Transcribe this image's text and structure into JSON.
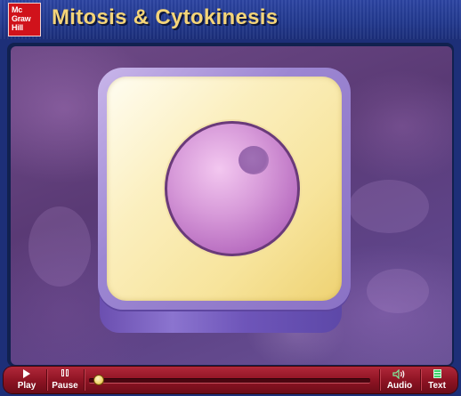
{
  "header": {
    "logo": {
      "lines": [
        "Mc",
        "Graw",
        "Hill"
      ]
    },
    "title": "Mitosis & Cytokinesis"
  },
  "colors": {
    "header_bg": "#22398f",
    "title_gold": "#f4d479",
    "logo_red": "#d0121b",
    "stage_purple": "#5e4387",
    "control_red": "#8f1424"
  },
  "stage": {
    "illustration": "cell-with-nucleus"
  },
  "controls": {
    "play": {
      "label": "Play",
      "icon": "play-icon"
    },
    "pause": {
      "label": "Pause",
      "icon": "pause-icon"
    },
    "progress": {
      "value": 0
    },
    "audio": {
      "label": "Audio",
      "icon": "speaker-icon"
    },
    "text": {
      "label": "Text",
      "icon": "text-icon"
    }
  }
}
